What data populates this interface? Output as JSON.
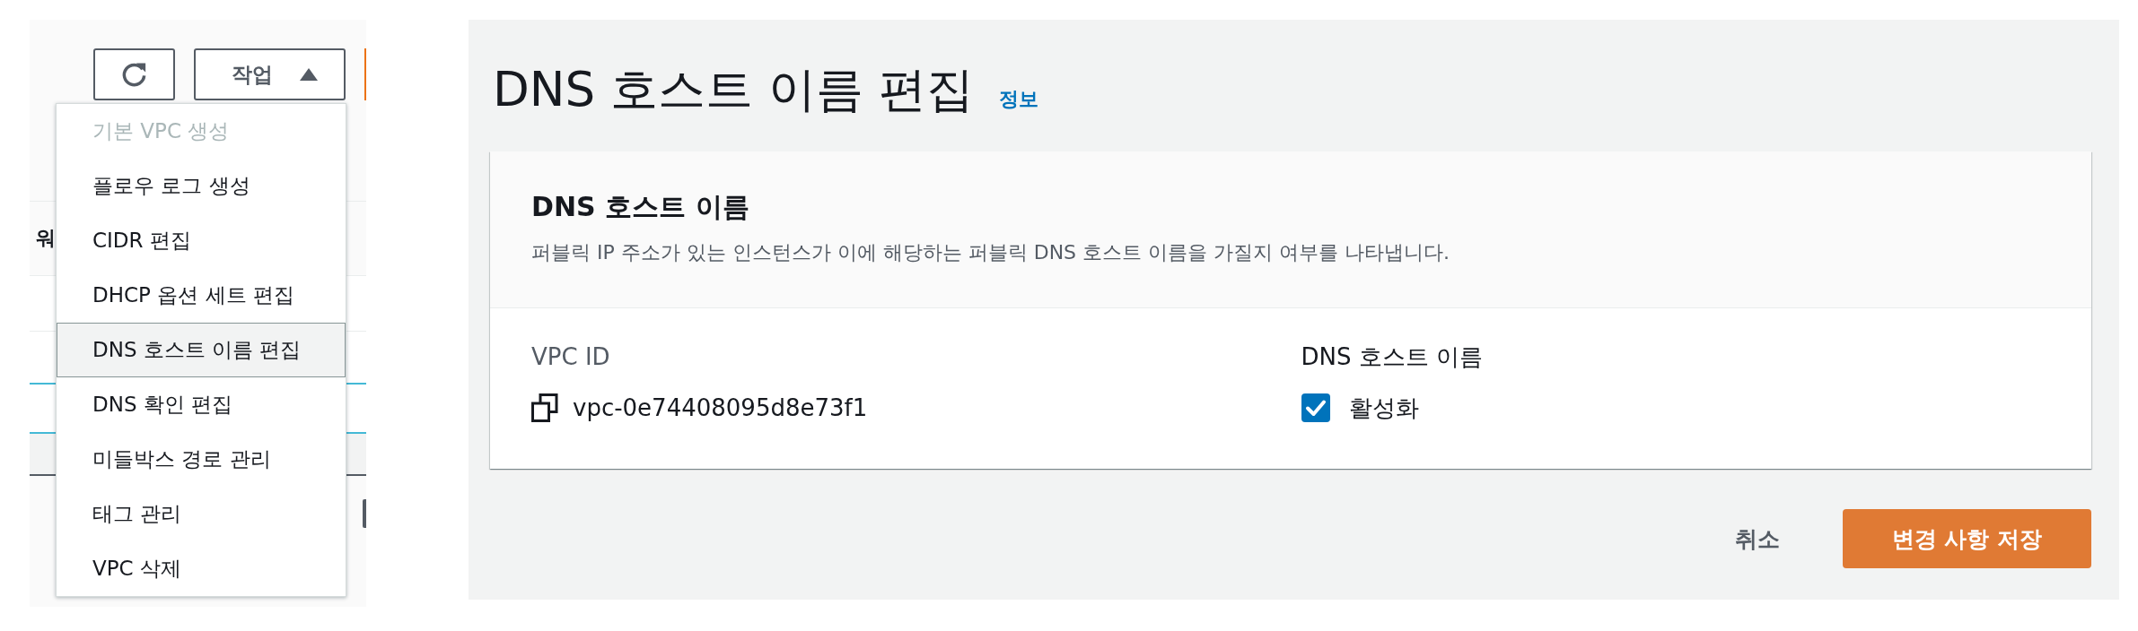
{
  "toolbar": {
    "actions_button": {
      "label": "작업",
      "expanded": true
    }
  },
  "actions_menu": {
    "items": [
      {
        "label": "기본 VPC 생성",
        "disabled": true,
        "selected": false
      },
      {
        "label": "플로우 로그 생성",
        "disabled": false,
        "selected": false
      },
      {
        "label": "CIDR 편집",
        "disabled": false,
        "selected": false
      },
      {
        "label": "DHCP 옵션 세트 편집",
        "disabled": false,
        "selected": false
      },
      {
        "label": "DNS 호스트 이름 편집",
        "disabled": false,
        "selected": true
      },
      {
        "label": "DNS 확인 편집",
        "disabled": false,
        "selected": false
      },
      {
        "label": "미들박스 경로 관리",
        "disabled": false,
        "selected": false
      },
      {
        "label": "태그 관리",
        "disabled": false,
        "selected": false
      },
      {
        "label": "VPC 삭제",
        "disabled": false,
        "selected": false
      }
    ]
  },
  "table": {
    "columns": [
      "워"
    ],
    "rows": [
      {
        "selected": false
      },
      {
        "selected": false
      },
      {
        "selected": true
      }
    ]
  },
  "page": {
    "title": "DNS 호스트 이름 편집",
    "info_link": "정보"
  },
  "card": {
    "title": "DNS 호스트 이름",
    "description": "퍼블릭 IP 주소가 있는 인스턴스가 이에 해당하는 퍼블릭 DNS 호스트 이름을 가질지 여부를 나타냅니다.",
    "fields": [
      {
        "kind": "copyable",
        "label": "VPC ID",
        "value": "vpc-0e74408095d8e73f1"
      },
      {
        "kind": "checkbox",
        "label": "DNS 호스트 이름",
        "option": "활성화",
        "checked": true
      }
    ]
  },
  "footer": {
    "buttons": [
      {
        "kind": "link",
        "label": "취소"
      },
      {
        "kind": "primary",
        "label": "변경 사항 저장"
      }
    ]
  }
}
